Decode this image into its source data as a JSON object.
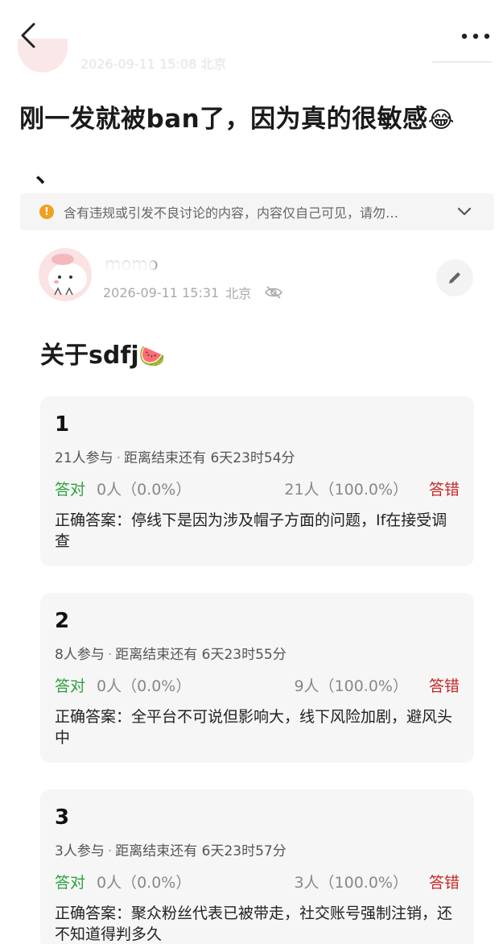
{
  "ghost_header": {
    "meta": "2026-09-11 15:08 北京"
  },
  "post": {
    "title": "刚一发就被ban了，因为真的很敏感",
    "title_emoji": "😂",
    "title_tail": "、"
  },
  "warning": {
    "text": "含有违规或引发不良讨论的内容，内容仅自己可见，请勿…"
  },
  "author": {
    "name": "momo",
    "timestamp": "2026-09-11 15:31",
    "location": "北京"
  },
  "sub_post": {
    "title": "关于sdfj",
    "emoji": "🍉"
  },
  "quizzes": [
    {
      "number": "1",
      "participants": "21人参与",
      "sep": "·",
      "remaining": "距离结束还有 6天23时54分",
      "right_label": "答对",
      "right_value": "0人（0.0%）",
      "wrong_value": "21人（100.0%）",
      "wrong_label": "答错",
      "answer": "正确答案：停线下是因为涉及帽子方面的问题，If在接受调查"
    },
    {
      "number": "2",
      "participants": "8人参与",
      "sep": "·",
      "remaining": "距离结束还有 6天23时55分",
      "right_label": "答对",
      "right_value": "0人（0.0%）",
      "wrong_value": "9人（100.0%）",
      "wrong_label": "答错",
      "answer": "正确答案：全平台不可说但影响大，线下风险加剧，避风头中"
    },
    {
      "number": "3",
      "participants": "3人参与",
      "sep": "·",
      "remaining": "距离结束还有 6天23时57分",
      "right_label": "答对",
      "right_value": "0人（0.0%）",
      "wrong_value": "3人（100.0%）",
      "wrong_label": "答错",
      "answer": "正确答案：聚众粉丝代表已被带走，社交账号强制注销，还不知道得判多久"
    }
  ],
  "colors": {
    "right": "#2ea041",
    "wrong": "#c62828",
    "warning_icon": "#f0a020",
    "card_bg": "#f6f6f6"
  },
  "icons": [
    "back-arrow-icon",
    "more-dots-icon",
    "warning-icon",
    "chevron-down-icon",
    "eye-off-icon",
    "pencil-icon"
  ]
}
